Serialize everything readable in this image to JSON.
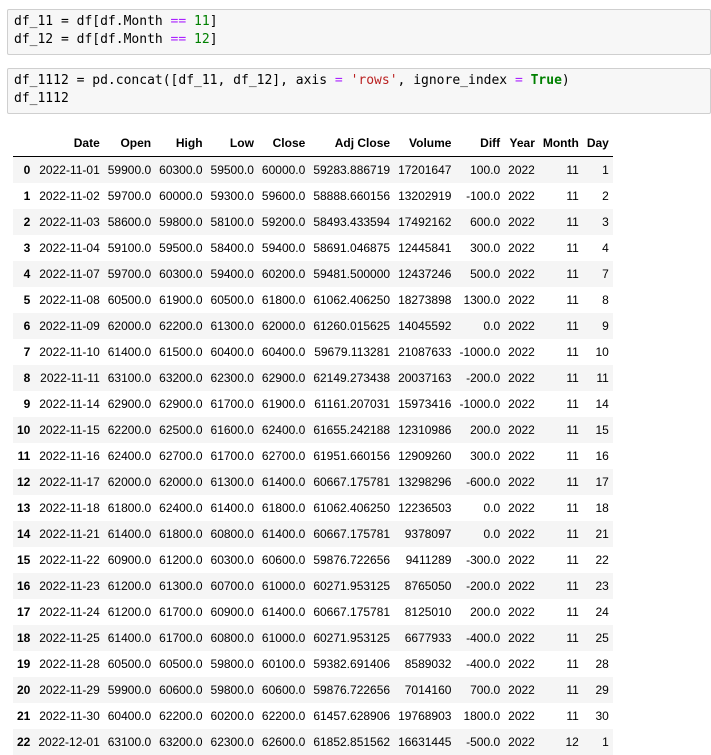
{
  "cell1": {
    "line1": {
      "a": "df_11",
      "eq": " = ",
      "b": "df[df.Month ",
      "op": "==",
      "sp": " ",
      "num": "11",
      "end": "]"
    },
    "line2": {
      "a": "df_12",
      "eq": " = ",
      "b": "df[df.Month ",
      "op": "==",
      "sp": " ",
      "num": "12",
      "end": "]"
    }
  },
  "cell2": {
    "line1": {
      "a": "df_1112",
      "eq": " = ",
      "b": "pd.concat([df_11, df_12], axis ",
      "op1": "=",
      "c": " ",
      "str": "'rows'",
      "d": ", ignore_index ",
      "op2": "=",
      "e": " ",
      "kw": "True",
      "end": ")"
    },
    "line2": "df_1112"
  },
  "table": {
    "columns": [
      "",
      "Date",
      "Open",
      "High",
      "Low",
      "Close",
      "Adj Close",
      "Volume",
      "Diff",
      "Year",
      "Month",
      "Day"
    ],
    "rows": [
      [
        "0",
        "2022-11-01",
        "59900.0",
        "60300.0",
        "59500.0",
        "60000.0",
        "59283.886719",
        "17201647",
        "100.0",
        "2022",
        "11",
        "1"
      ],
      [
        "1",
        "2022-11-02",
        "59700.0",
        "60000.0",
        "59300.0",
        "59600.0",
        "58888.660156",
        "13202919",
        "-100.0",
        "2022",
        "11",
        "2"
      ],
      [
        "2",
        "2022-11-03",
        "58600.0",
        "59800.0",
        "58100.0",
        "59200.0",
        "58493.433594",
        "17492162",
        "600.0",
        "2022",
        "11",
        "3"
      ],
      [
        "3",
        "2022-11-04",
        "59100.0",
        "59500.0",
        "58400.0",
        "59400.0",
        "58691.046875",
        "12445841",
        "300.0",
        "2022",
        "11",
        "4"
      ],
      [
        "4",
        "2022-11-07",
        "59700.0",
        "60300.0",
        "59400.0",
        "60200.0",
        "59481.500000",
        "12437246",
        "500.0",
        "2022",
        "11",
        "7"
      ],
      [
        "5",
        "2022-11-08",
        "60500.0",
        "61900.0",
        "60500.0",
        "61800.0",
        "61062.406250",
        "18273898",
        "1300.0",
        "2022",
        "11",
        "8"
      ],
      [
        "6",
        "2022-11-09",
        "62000.0",
        "62200.0",
        "61300.0",
        "62000.0",
        "61260.015625",
        "14045592",
        "0.0",
        "2022",
        "11",
        "9"
      ],
      [
        "7",
        "2022-11-10",
        "61400.0",
        "61500.0",
        "60400.0",
        "60400.0",
        "59679.113281",
        "21087633",
        "-1000.0",
        "2022",
        "11",
        "10"
      ],
      [
        "8",
        "2022-11-11",
        "63100.0",
        "63200.0",
        "62300.0",
        "62900.0",
        "62149.273438",
        "20037163",
        "-200.0",
        "2022",
        "11",
        "11"
      ],
      [
        "9",
        "2022-11-14",
        "62900.0",
        "62900.0",
        "61700.0",
        "61900.0",
        "61161.207031",
        "15973416",
        "-1000.0",
        "2022",
        "11",
        "14"
      ],
      [
        "10",
        "2022-11-15",
        "62200.0",
        "62500.0",
        "61600.0",
        "62400.0",
        "61655.242188",
        "12310986",
        "200.0",
        "2022",
        "11",
        "15"
      ],
      [
        "11",
        "2022-11-16",
        "62400.0",
        "62700.0",
        "61700.0",
        "62700.0",
        "61951.660156",
        "12909260",
        "300.0",
        "2022",
        "11",
        "16"
      ],
      [
        "12",
        "2022-11-17",
        "62000.0",
        "62000.0",
        "61300.0",
        "61400.0",
        "60667.175781",
        "13298296",
        "-600.0",
        "2022",
        "11",
        "17"
      ],
      [
        "13",
        "2022-11-18",
        "61800.0",
        "62400.0",
        "61400.0",
        "61800.0",
        "61062.406250",
        "12236503",
        "0.0",
        "2022",
        "11",
        "18"
      ],
      [
        "14",
        "2022-11-21",
        "61400.0",
        "61800.0",
        "60800.0",
        "61400.0",
        "60667.175781",
        "9378097",
        "0.0",
        "2022",
        "11",
        "21"
      ],
      [
        "15",
        "2022-11-22",
        "60900.0",
        "61200.0",
        "60300.0",
        "60600.0",
        "59876.722656",
        "9411289",
        "-300.0",
        "2022",
        "11",
        "22"
      ],
      [
        "16",
        "2022-11-23",
        "61200.0",
        "61300.0",
        "60700.0",
        "61000.0",
        "60271.953125",
        "8765050",
        "-200.0",
        "2022",
        "11",
        "23"
      ],
      [
        "17",
        "2022-11-24",
        "61200.0",
        "61700.0",
        "60900.0",
        "61400.0",
        "60667.175781",
        "8125010",
        "200.0",
        "2022",
        "11",
        "24"
      ],
      [
        "18",
        "2022-11-25",
        "61400.0",
        "61700.0",
        "60800.0",
        "61000.0",
        "60271.953125",
        "6677933",
        "-400.0",
        "2022",
        "11",
        "25"
      ],
      [
        "19",
        "2022-11-28",
        "60500.0",
        "60500.0",
        "59800.0",
        "60100.0",
        "59382.691406",
        "8589032",
        "-400.0",
        "2022",
        "11",
        "28"
      ],
      [
        "20",
        "2022-11-29",
        "59900.0",
        "60600.0",
        "59800.0",
        "60600.0",
        "59876.722656",
        "7014160",
        "700.0",
        "2022",
        "11",
        "29"
      ],
      [
        "21",
        "2022-11-30",
        "60400.0",
        "62200.0",
        "60200.0",
        "62200.0",
        "61457.628906",
        "19768903",
        "1800.0",
        "2022",
        "11",
        "30"
      ],
      [
        "22",
        "2022-12-01",
        "63100.0",
        "63200.0",
        "62300.0",
        "62600.0",
        "61852.851562",
        "16631445",
        "-500.0",
        "2022",
        "12",
        "1"
      ]
    ]
  }
}
